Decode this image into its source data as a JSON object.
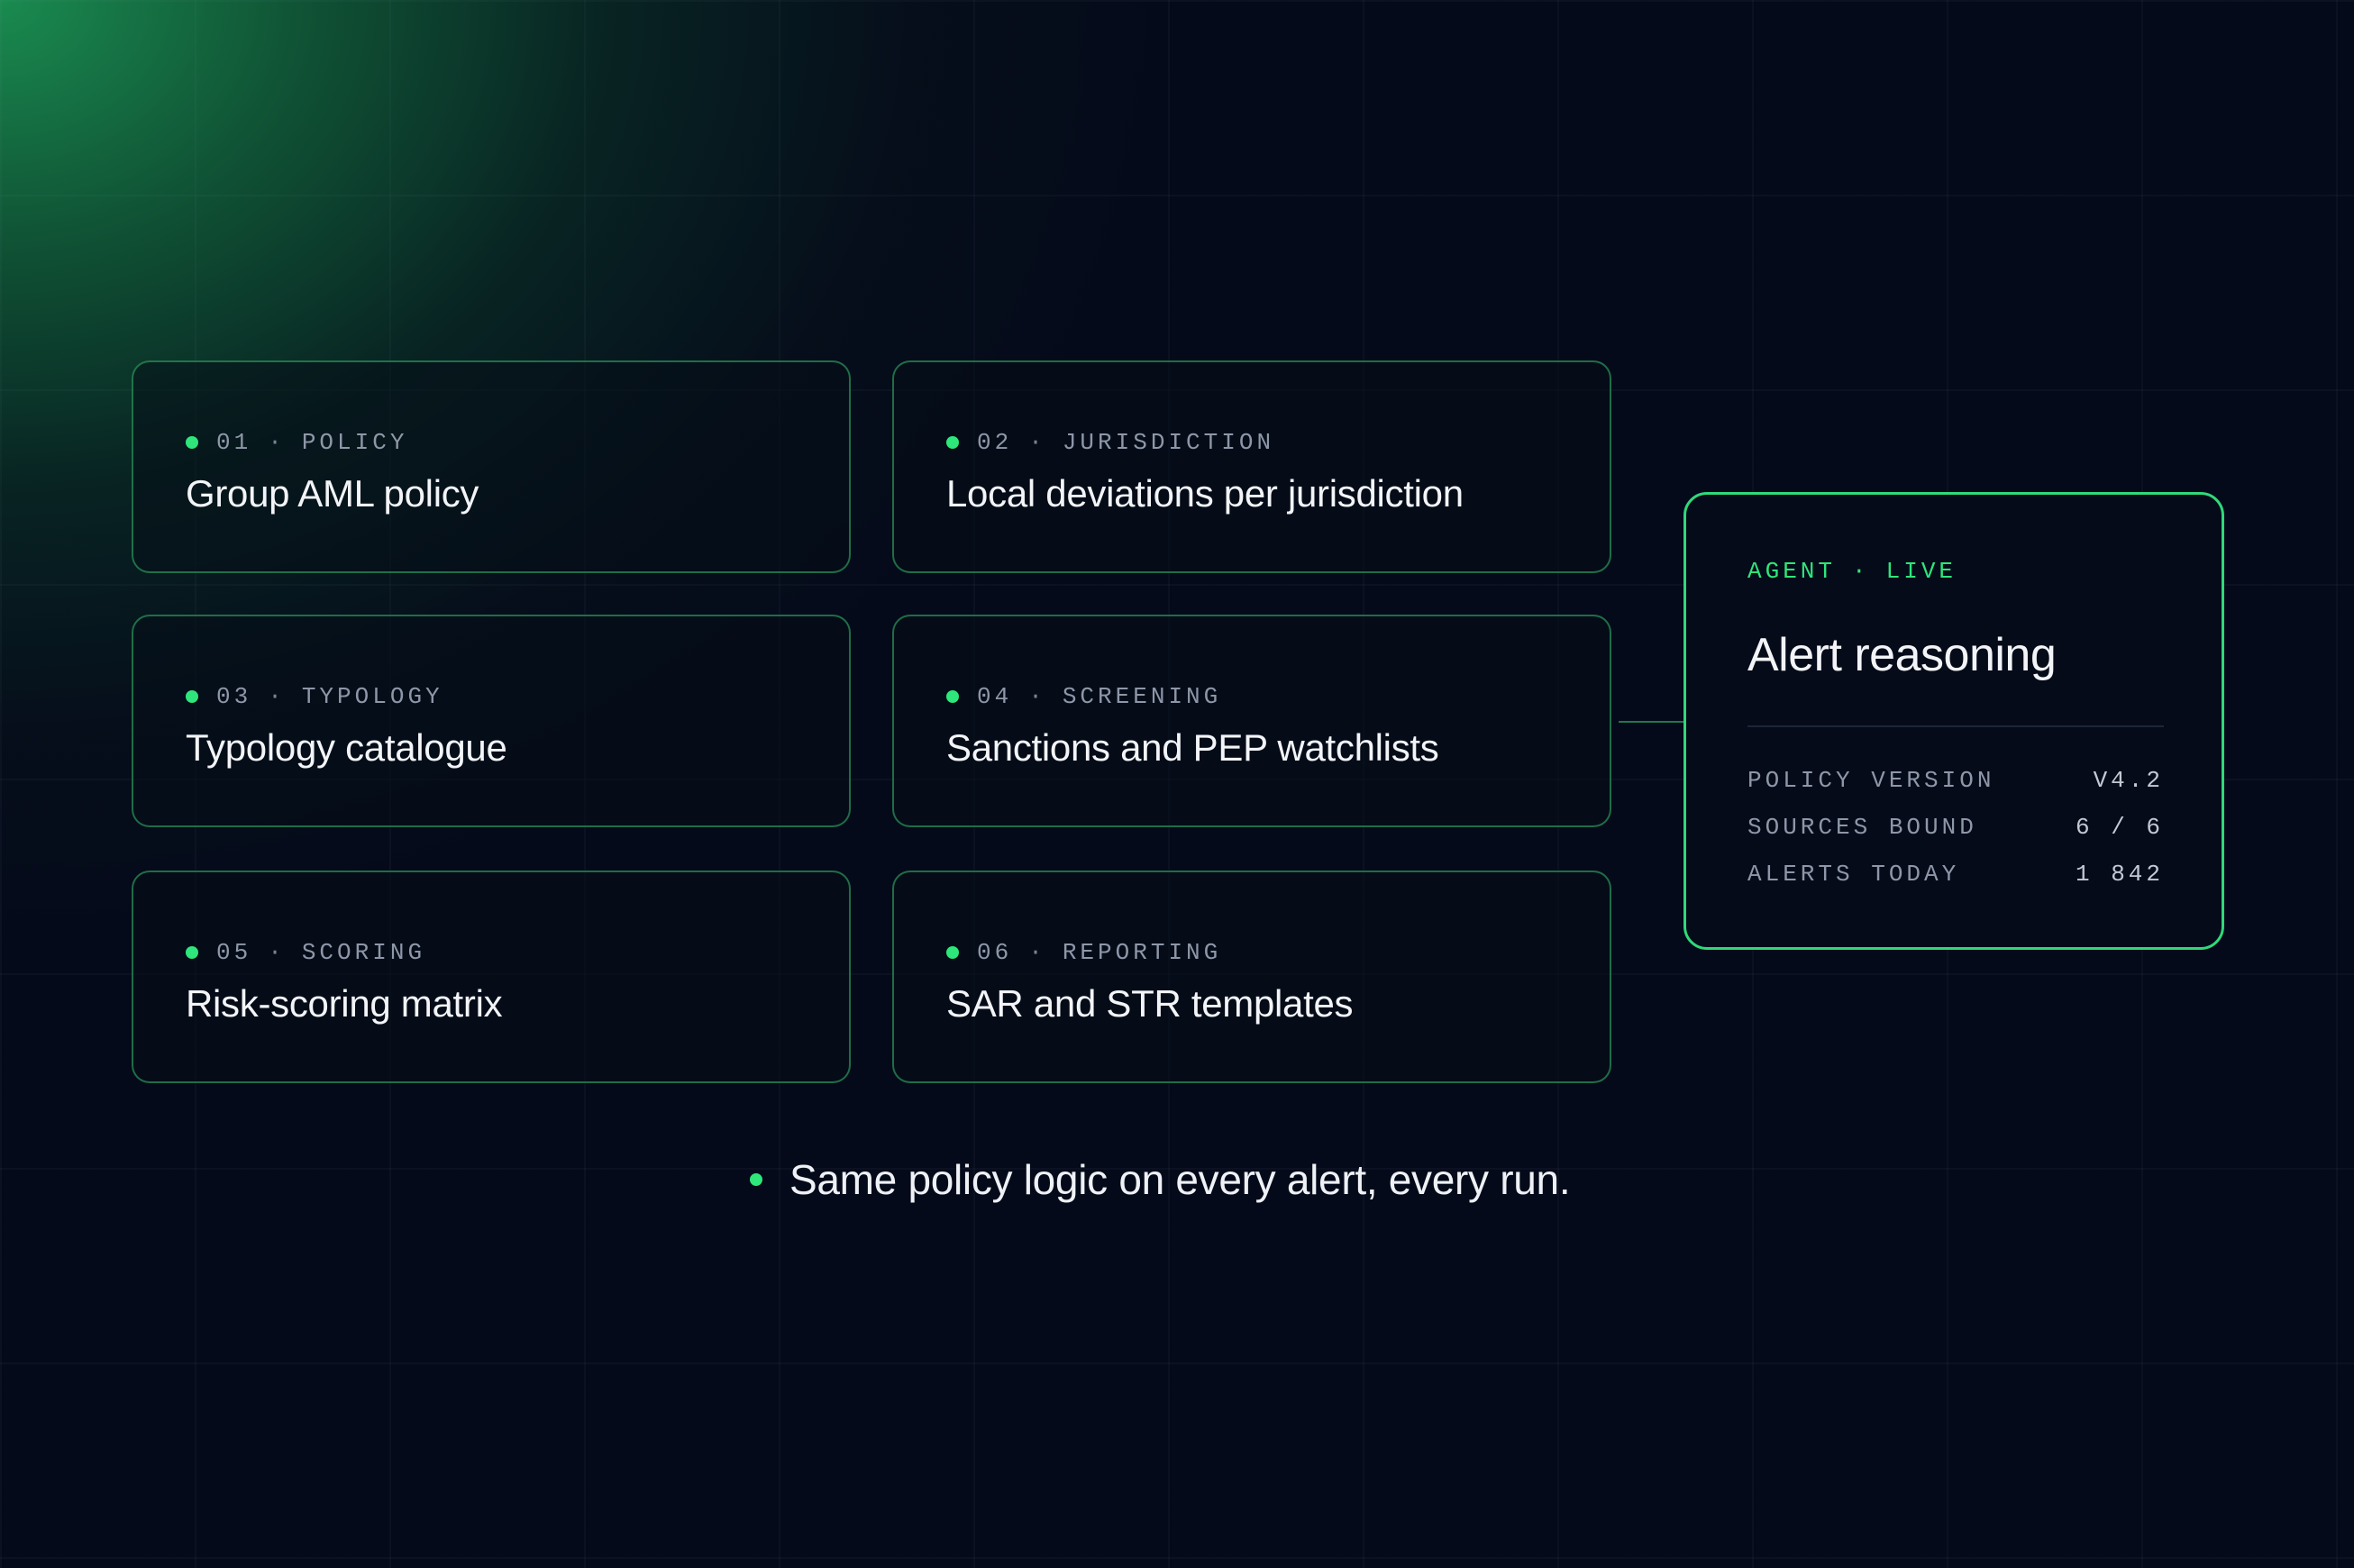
{
  "cards": [
    {
      "num": "01",
      "category": "POLICY",
      "title": "Group AML policy"
    },
    {
      "num": "02",
      "category": "JURISDICTION",
      "title": "Local deviations per jurisdiction"
    },
    {
      "num": "03",
      "category": "TYPOLOGY",
      "title": "Typology catalogue"
    },
    {
      "num": "04",
      "category": "SCREENING",
      "title": "Sanctions and PEP watchlists"
    },
    {
      "num": "05",
      "category": "SCORING",
      "title": "Risk-scoring matrix"
    },
    {
      "num": "06",
      "category": "REPORTING",
      "title": "SAR and STR templates"
    }
  ],
  "separator": "·",
  "agent": {
    "label": "AGENT",
    "status": "LIVE",
    "title": "Alert reasoning",
    "stats": [
      {
        "label": "POLICY VERSION",
        "value": "V4.2"
      },
      {
        "label": "SOURCES BOUND",
        "value": "6 / 6"
      },
      {
        "label": "ALERTS TODAY",
        "value": "1 842"
      }
    ]
  },
  "footer": {
    "text": "Same policy logic on every alert, every run."
  },
  "colors": {
    "accent": "#2ee67a",
    "background": "#050a1a",
    "card_border": "#34be6e",
    "text": "#f2f4f7",
    "muted": "#8e97a8"
  }
}
